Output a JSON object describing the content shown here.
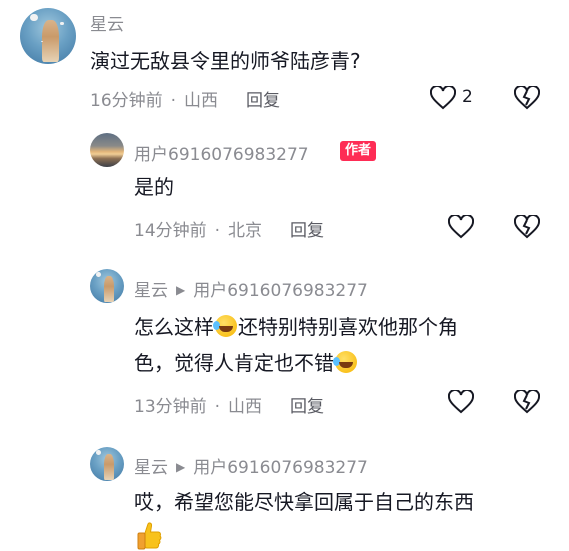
{
  "comments": [
    {
      "username": "星云",
      "text": "演过无敌县令里的师爷陆彦青?",
      "time": "16分钟前",
      "location": "山西",
      "reply_label": "回复",
      "like_count": "2"
    },
    {
      "username": "用户6916076983277",
      "badge": "作者",
      "text": "是的",
      "time": "14分钟前",
      "location": "北京",
      "reply_label": "回复"
    },
    {
      "username": "星云",
      "reply_to": "用户6916076983277",
      "text_line1_a": "怎么这样",
      "text_line1_b": "还特别特别喜欢他那个角",
      "text_line2": "色，觉得人肯定也不错",
      "time": "13分钟前",
      "location": "山西",
      "reply_label": "回复"
    },
    {
      "username": "星云",
      "reply_to": "用户6916076983277",
      "text": "哎，希望您能尽快拿回属于自己的东西",
      "emoji": "thumbs-up"
    }
  ],
  "icons": {
    "like": "heart-outline-icon",
    "dislike": "broken-heart-outline-icon",
    "reply_arrow": "triangle-right-icon",
    "laugh_emoji": "rolling-laugh-emoji",
    "thumb_emoji": "thumbs-up-emoji"
  },
  "colors": {
    "badge": "#fe2c55",
    "muted": "#8a8b91",
    "text": "#161823"
  }
}
